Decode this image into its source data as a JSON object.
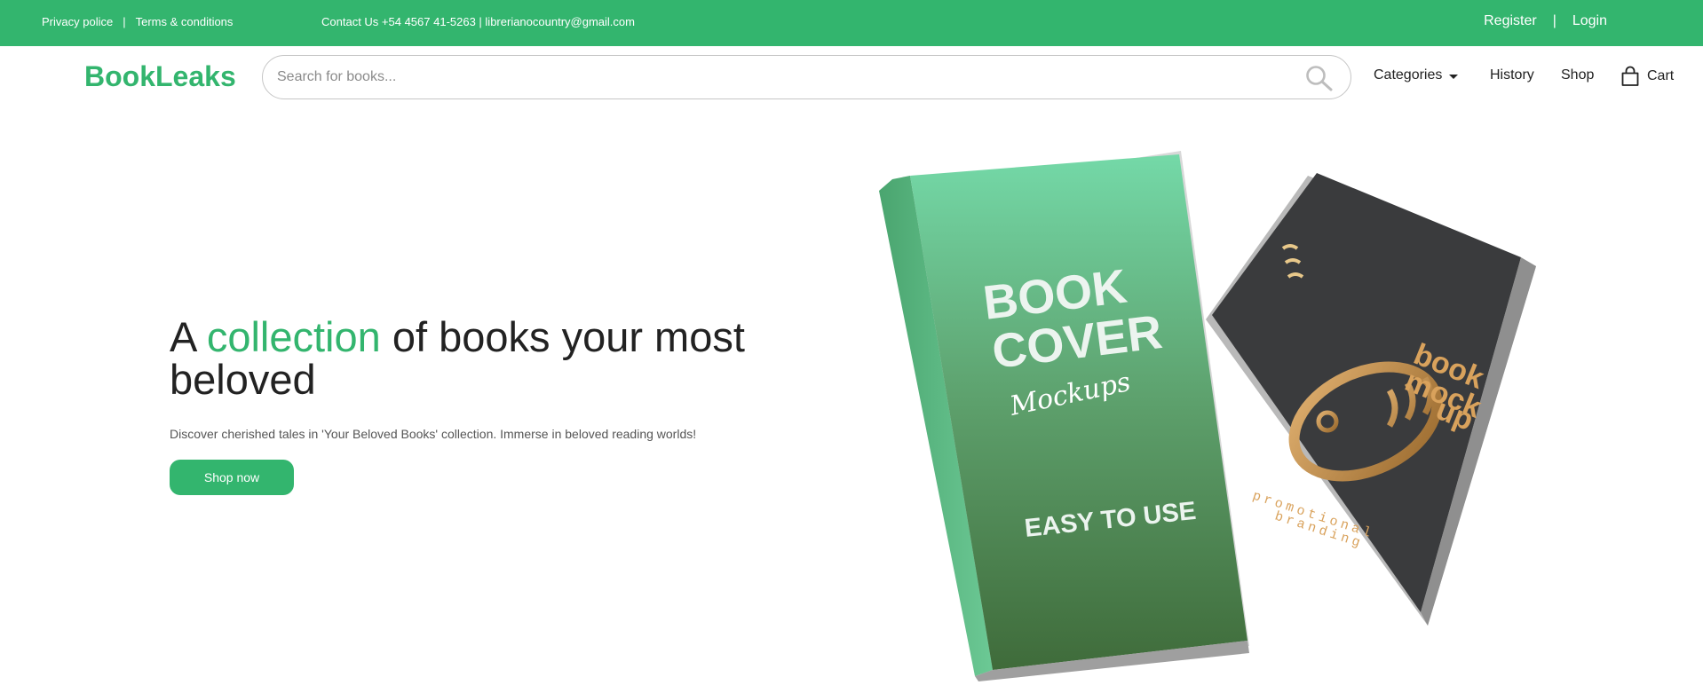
{
  "topbar": {
    "privacy": "Privacy police",
    "separator": "|",
    "terms": "Terms & conditions",
    "contact": "Contact Us +54 4567 41-5263 | librerianocountry@gmail.com",
    "register": "Register",
    "login": "Login"
  },
  "header": {
    "logo": "BookLeaks",
    "search_placeholder": "Search for books...",
    "nav": {
      "categories": "Categories",
      "history": "History",
      "shop": "Shop",
      "cart": "Cart"
    }
  },
  "hero": {
    "title_before": "A ",
    "title_accent": "collection",
    "title_after": " of books your most beloved",
    "subtitle": "Discover cherished tales in 'Your Beloved Books' collection. Immerse in beloved reading worlds!",
    "cta": "Shop now"
  },
  "illustration": {
    "green_book": {
      "line1": "BOOK",
      "line2": "COVER",
      "signature": "Mockups",
      "tagline": "EASY TO USE"
    },
    "dark_book": {
      "title1": "book",
      "title2": "mock",
      "title3": "up",
      "tagline1": "promotional",
      "tagline2": "branding"
    }
  },
  "colors": {
    "brand": "#33b56e",
    "text": "#222222"
  }
}
